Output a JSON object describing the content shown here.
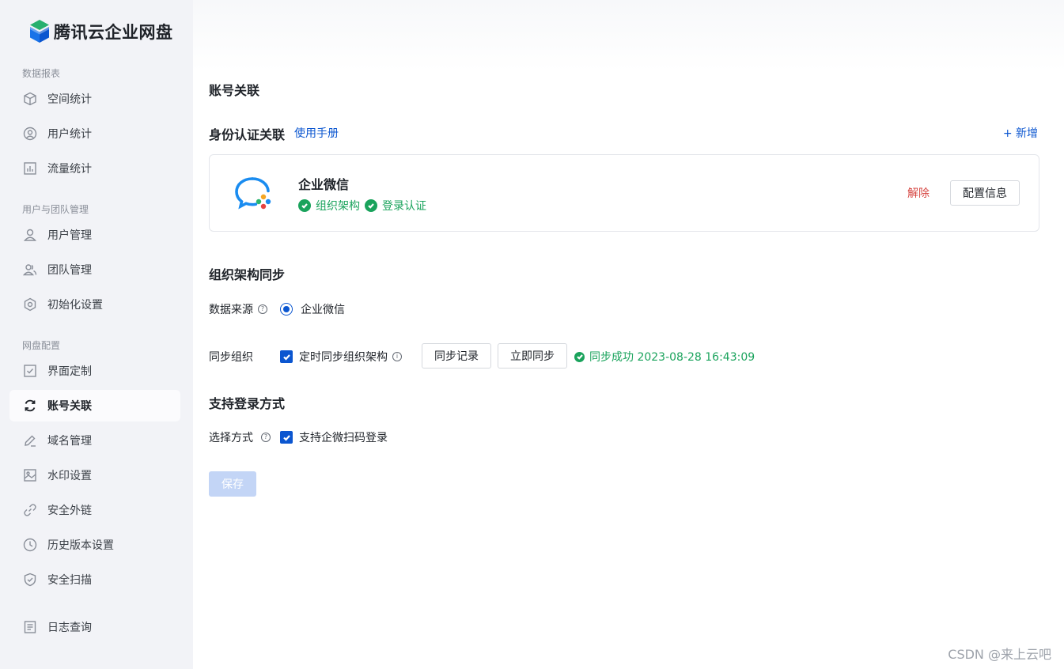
{
  "app": {
    "name": "腾讯云企业网盘"
  },
  "sidebar": {
    "groups": [
      {
        "title": "数据报表",
        "items": [
          {
            "label": "空间统计",
            "icon": "cube-icon"
          },
          {
            "label": "用户统计",
            "icon": "user-circle-icon"
          },
          {
            "label": "流量统计",
            "icon": "bar-chart-icon"
          }
        ]
      },
      {
        "title": "用户与团队管理",
        "items": [
          {
            "label": "用户管理",
            "icon": "user-icon"
          },
          {
            "label": "团队管理",
            "icon": "team-icon"
          },
          {
            "label": "初始化设置",
            "icon": "hexagon-settings-icon"
          }
        ]
      },
      {
        "title": "网盘配置",
        "items": [
          {
            "label": "界面定制",
            "icon": "checkbox-square-icon"
          },
          {
            "label": "账号关联",
            "icon": "sync-icon",
            "active": true
          },
          {
            "label": "域名管理",
            "icon": "edit-icon"
          },
          {
            "label": "水印设置",
            "icon": "image-icon"
          },
          {
            "label": "安全外链",
            "icon": "link-icon"
          },
          {
            "label": "历史版本设置",
            "icon": "clock-icon"
          },
          {
            "label": "安全扫描",
            "icon": "shield-icon"
          }
        ]
      }
    ],
    "log_item": {
      "label": "日志查询",
      "icon": "document-icon"
    }
  },
  "main": {
    "page_title": "账号关联",
    "identity": {
      "title": "身份认证关联",
      "manual_link": "使用手册",
      "add_link": "+ 新增",
      "card": {
        "name": "企业微信",
        "logo": "wecom-logo",
        "tags": [
          "组织架构",
          "登录认证"
        ],
        "remove_label": "解除",
        "config_label": "配置信息"
      }
    },
    "org_sync": {
      "title": "组织架构同步",
      "source_label": "数据来源",
      "source_option": "企业微信",
      "sync_label": "同步组织",
      "scheduled_sync_label": "定时同步组织架构",
      "history_button": "同步记录",
      "sync_now_button": "立即同步",
      "status_text": "同步成功 2023-08-28 16:43:09"
    },
    "login": {
      "title": "支持登录方式",
      "method_label": "选择方式",
      "qr_login_label": "支持企微扫码登录"
    },
    "save_button": "保存"
  },
  "watermark": "CSDN @来上云吧",
  "colors": {
    "accent": "#0b56d0",
    "success": "#1aa35c",
    "danger": "#d64541",
    "sidebar_bg": "#f2f3f7"
  }
}
